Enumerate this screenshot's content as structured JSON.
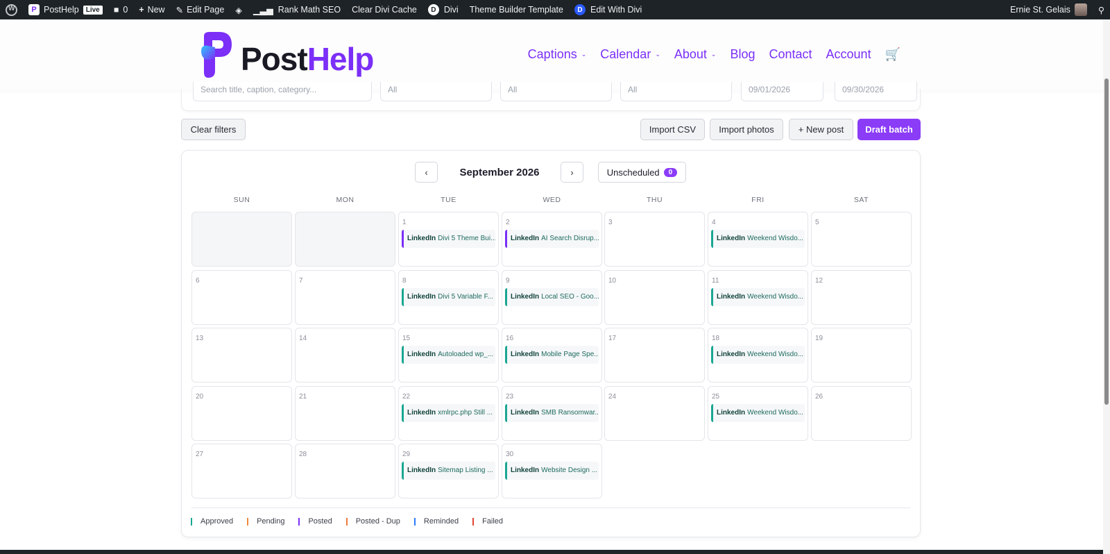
{
  "adminbar": {
    "site": "PostHelp",
    "live": "Live",
    "comments": "0",
    "new": "New",
    "edit_page": "Edit Page",
    "rank_math": "Rank Math SEO",
    "clear_cache": "Clear Divi Cache",
    "divi": "Divi",
    "theme_builder": "Theme Builder Template",
    "edit_with_divi": "Edit With Divi",
    "user": "Ernie St. Gelais"
  },
  "header": {
    "logo_part1": "Post",
    "logo_part2": "Help",
    "nav": [
      "Captions",
      "Calendar",
      "About",
      "Blog",
      "Contact",
      "Account"
    ]
  },
  "filters": {
    "search_placeholder": "Search title, caption, category...",
    "select1": "All",
    "select2": "All",
    "select3": "All",
    "date_from": "09/01/2026",
    "date_to": "09/30/2026"
  },
  "toolbar": {
    "clear_filters": "Clear filters",
    "import_csv": "Import CSV",
    "import_photos": "Import photos",
    "new_post": "+ New post",
    "draft_batch": "Draft batch"
  },
  "calendar": {
    "prev": "‹",
    "next": "›",
    "month": "September 2026",
    "unscheduled_label": "Unscheduled",
    "unscheduled_count": "0",
    "days": [
      "SUN",
      "MON",
      "TUE",
      "WED",
      "THU",
      "FRI",
      "SAT"
    ],
    "cells": [
      {
        "day": "",
        "blank": true
      },
      {
        "day": "",
        "blank": true
      },
      {
        "day": "1",
        "platform": "LinkedIn",
        "title": "Divi 5 Theme Bui...",
        "status": "posted"
      },
      {
        "day": "2",
        "platform": "LinkedIn",
        "title": "AI Search Disrup...",
        "status": "posted"
      },
      {
        "day": "3"
      },
      {
        "day": "4",
        "platform": "LinkedIn",
        "title": "Weekend Wisdo...",
        "status": "approved"
      },
      {
        "day": "5"
      },
      {
        "day": "6"
      },
      {
        "day": "7"
      },
      {
        "day": "8",
        "platform": "LinkedIn",
        "title": "Divi 5 Variable F...",
        "status": "approved"
      },
      {
        "day": "9",
        "platform": "LinkedIn",
        "title": "Local SEO - Goo...",
        "status": "approved"
      },
      {
        "day": "10"
      },
      {
        "day": "11",
        "platform": "LinkedIn",
        "title": "Weekend Wisdo...",
        "status": "approved"
      },
      {
        "day": "12"
      },
      {
        "day": "13"
      },
      {
        "day": "14"
      },
      {
        "day": "15",
        "platform": "LinkedIn",
        "title": "Autoloaded wp_...",
        "status": "approved"
      },
      {
        "day": "16",
        "platform": "LinkedIn",
        "title": "Mobile Page Spe...",
        "status": "approved"
      },
      {
        "day": "17"
      },
      {
        "day": "18",
        "platform": "LinkedIn",
        "title": "Weekend Wisdo...",
        "status": "approved"
      },
      {
        "day": "19"
      },
      {
        "day": "20"
      },
      {
        "day": "21"
      },
      {
        "day": "22",
        "platform": "LinkedIn",
        "title": "xmlrpc.php Still ...",
        "status": "approved"
      },
      {
        "day": "23",
        "platform": "LinkedIn",
        "title": "SMB Ransomwar...",
        "status": "approved"
      },
      {
        "day": "24"
      },
      {
        "day": "25",
        "platform": "LinkedIn",
        "title": "Weekend Wisdo...",
        "status": "approved"
      },
      {
        "day": "26"
      },
      {
        "day": "27"
      },
      {
        "day": "28"
      },
      {
        "day": "29",
        "platform": "LinkedIn",
        "title": "Sitemap Listing ...",
        "status": "approved"
      },
      {
        "day": "30",
        "platform": "LinkedIn",
        "title": "Website Design ...",
        "status": "approved"
      }
    ]
  },
  "legend": [
    {
      "label": "Approved",
      "color": "#1aa692"
    },
    {
      "label": "Pending",
      "color": "#f08a3c"
    },
    {
      "label": "Posted",
      "color": "#7b2ff7"
    },
    {
      "label": "Posted - Dup",
      "color": "#f07a3c"
    },
    {
      "label": "Reminded",
      "color": "#2b7bff"
    },
    {
      "label": "Failed",
      "color": "#e0442f"
    }
  ]
}
